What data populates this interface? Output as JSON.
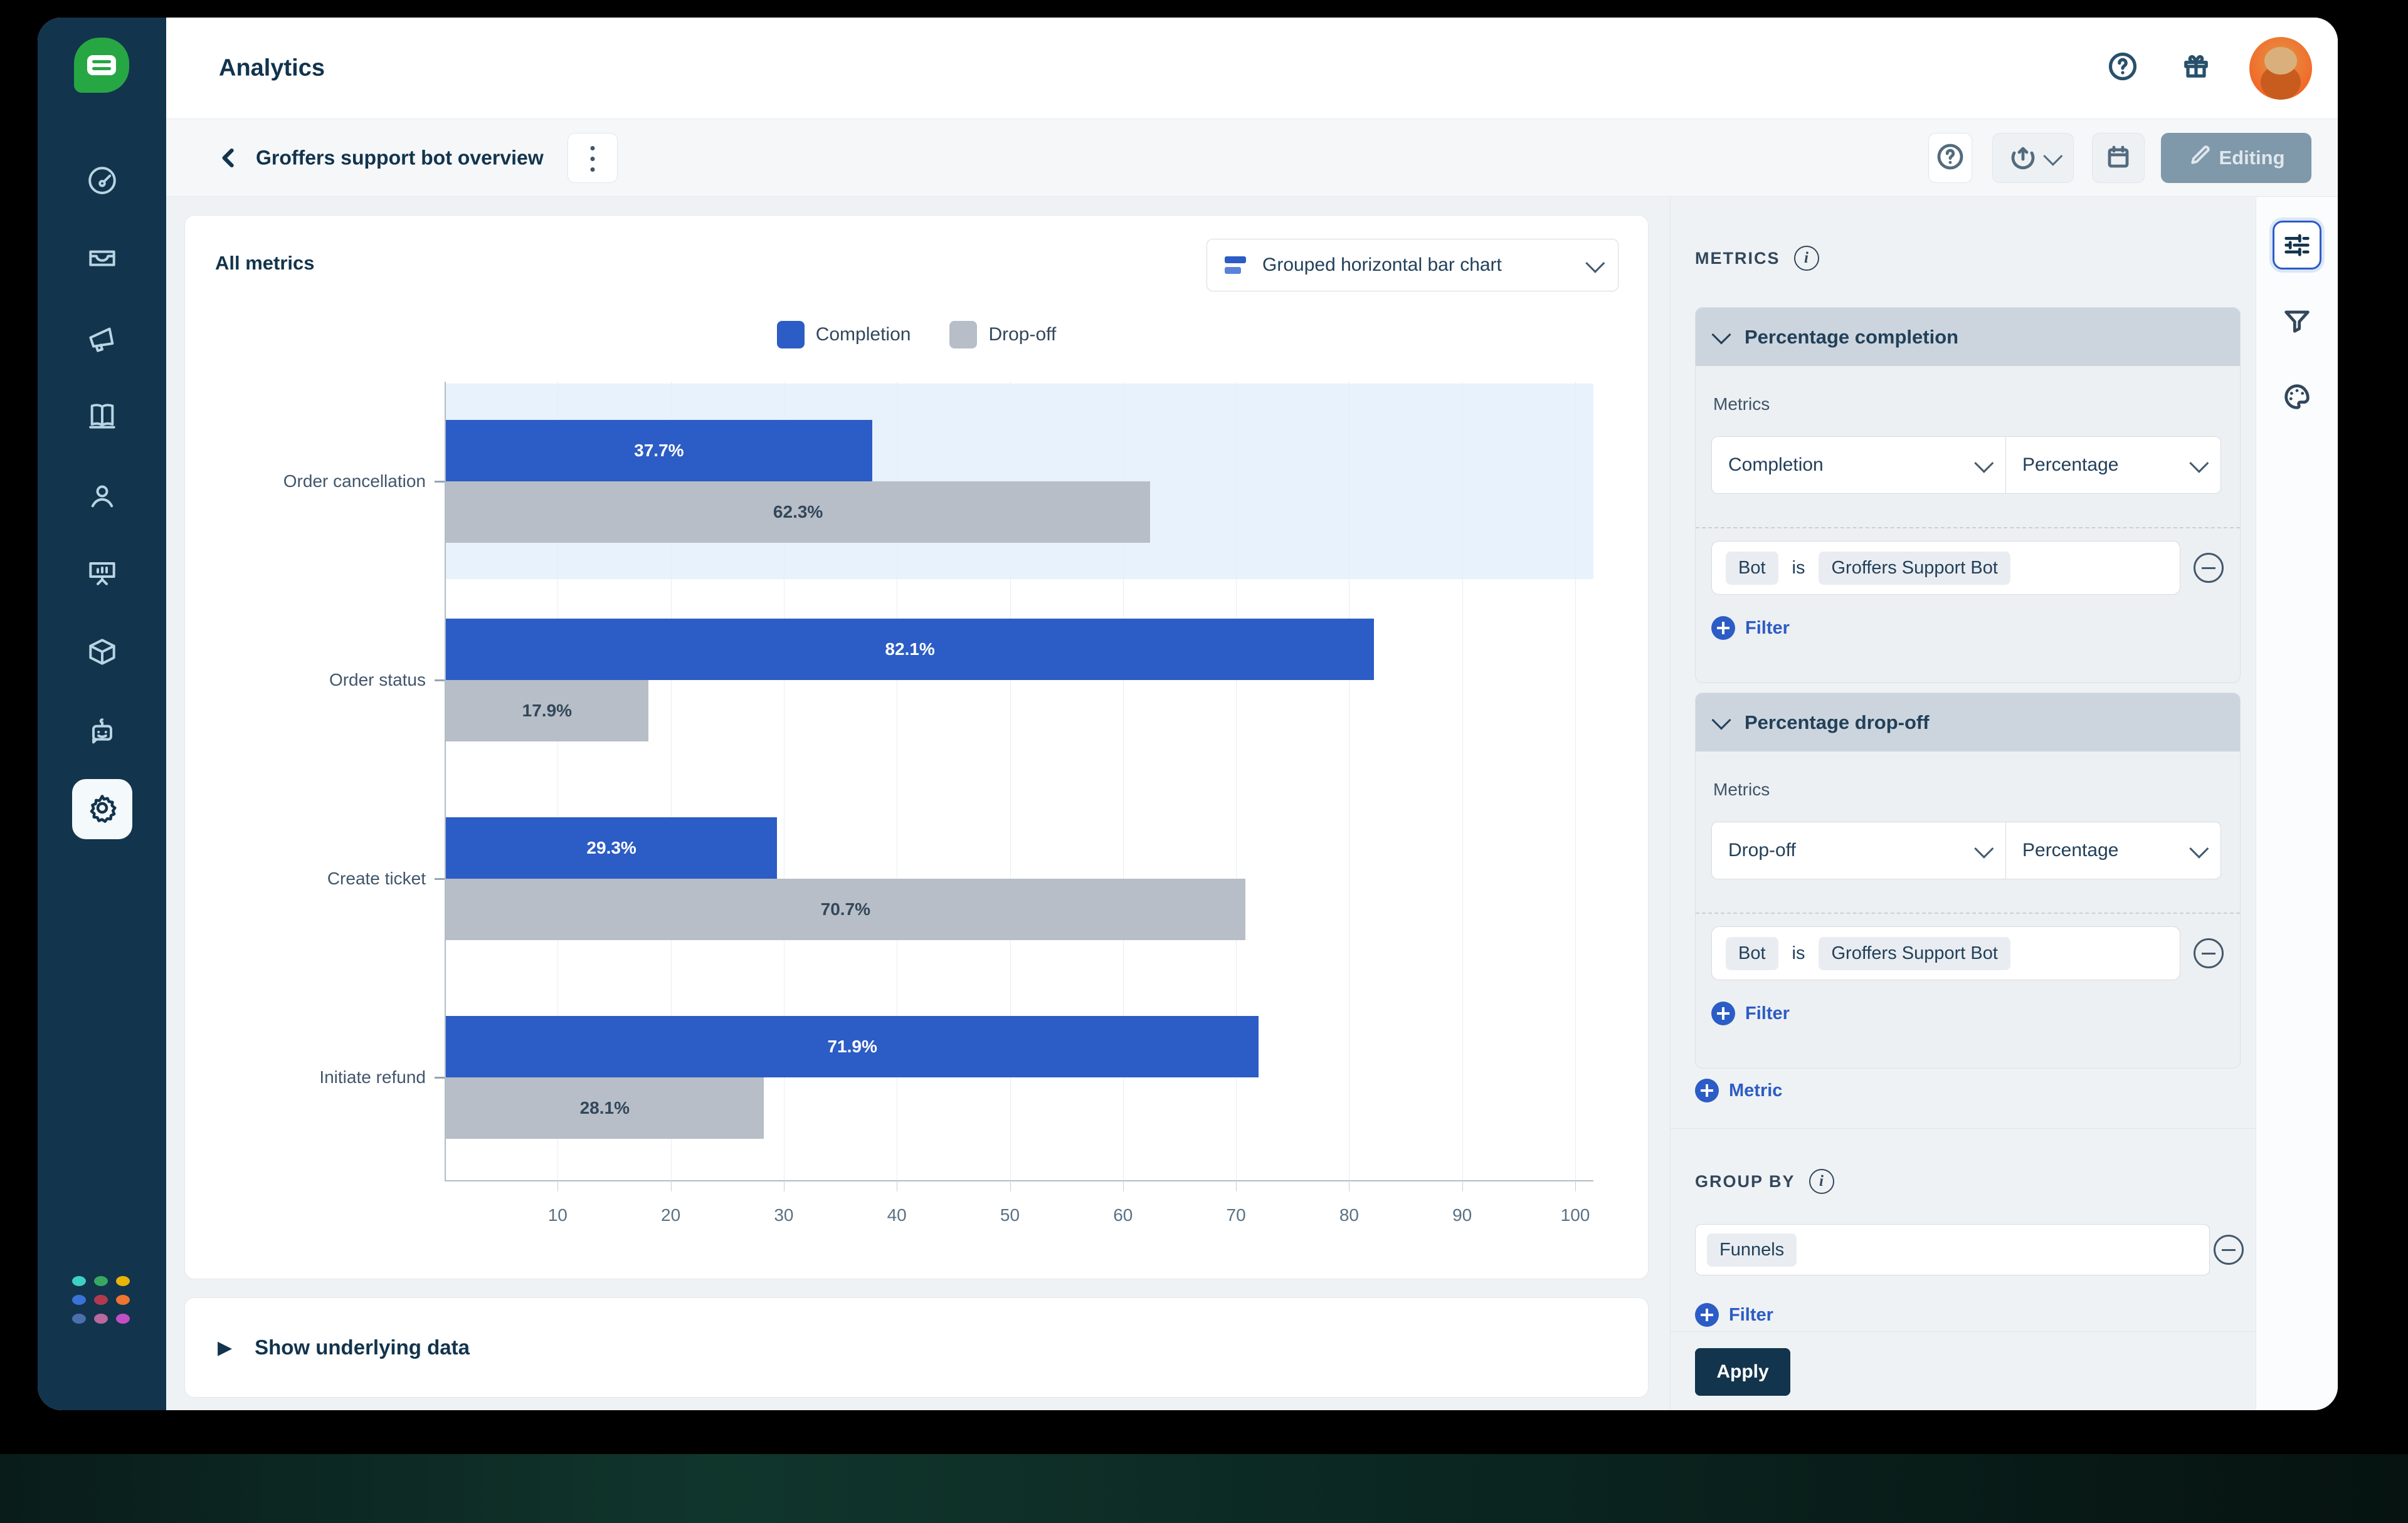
{
  "topbar": {
    "title": "Analytics"
  },
  "breadcrumb": {
    "title": "Groffers support bot overview"
  },
  "toolbar_right": {
    "editing_label": "Editing"
  },
  "chart_card": {
    "title": "All metrics",
    "chart_type": "Grouped horizontal bar chart"
  },
  "chart_data": {
    "type": "bar",
    "orientation": "horizontal",
    "grouped": true,
    "categories": [
      "Order cancellation",
      "Order status",
      "Create ticket",
      "Initiate refund"
    ],
    "series": [
      {
        "name": "Completion",
        "values": [
          37.7,
          82.1,
          29.3,
          71.9
        ],
        "color": "#2c5cc5",
        "label_color": "#ffffff"
      },
      {
        "name": "Drop-off",
        "values": [
          62.3,
          17.9,
          70.7,
          28.1
        ],
        "color": "#b7bec7",
        "label_color": "#33475b"
      }
    ],
    "value_suffix": "%",
    "xlim": [
      0,
      100
    ],
    "ticks": [
      10,
      20,
      30,
      40,
      50,
      60,
      70,
      80,
      90,
      100
    ],
    "grid": true,
    "legend_position": "top-center",
    "highlighted_category": "Order cancellation",
    "highlight_color": "#e8f2fc"
  },
  "underlying": {
    "label": "Show underlying data"
  },
  "right_panel": {
    "metrics_header": "METRICS",
    "sections": [
      {
        "title": "Percentage completion",
        "metrics_label": "Metrics",
        "metric": "Completion",
        "aggregation": "Percentage",
        "filter": {
          "field": "Bot",
          "op": "is",
          "value": "Groffers Support Bot"
        },
        "add_filter_label": "Filter"
      },
      {
        "title": "Percentage drop-off",
        "metrics_label": "Metrics",
        "metric": "Drop-off",
        "aggregation": "Percentage",
        "filter": {
          "field": "Bot",
          "op": "is",
          "value": "Groffers Support Bot"
        },
        "add_filter_label": "Filter"
      }
    ],
    "add_metric_label": "Metric",
    "group_by": {
      "header": "GROUP BY",
      "value": "Funnels",
      "add_filter_label": "Filter"
    },
    "apply_label": "Apply"
  },
  "icons": {
    "sidebar": [
      "dashboard-icon",
      "inbox-icon",
      "megaphone-icon",
      "book-icon",
      "person-icon",
      "presentation-icon",
      "cube-icon",
      "bot-icon",
      "gear-icon",
      "app-grid-icon"
    ],
    "topbar": [
      "help-icon",
      "gift-icon",
      "avatar"
    ],
    "subbar": [
      "back-icon",
      "kebab-menu-icon",
      "help-icon",
      "export-icon",
      "calendar-icon",
      "pencil-icon"
    ],
    "tool_strip": [
      "sliders-icon",
      "funnel-icon",
      "palette-icon"
    ]
  },
  "colors": {
    "sidebar_navy": "#12344d",
    "logo_green": "#27a644",
    "accent_blue": "#2c5cc5",
    "bar_gray": "#b7bec7",
    "highlight_band": "#e8f2fc",
    "apply_navy": "#12344d",
    "editing_button": "#7f98aa"
  }
}
